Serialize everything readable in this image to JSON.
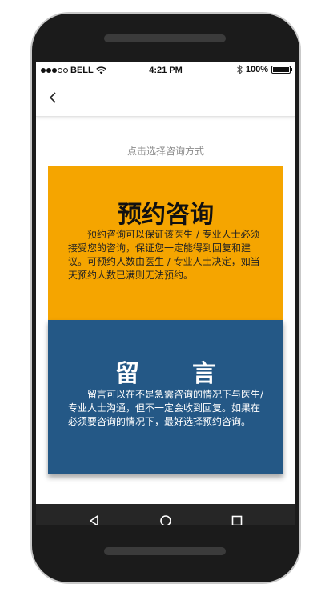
{
  "status_bar": {
    "carrier": "BELL",
    "time": "4:21 PM",
    "battery_text": "100%",
    "battery_level": 1.0,
    "signal_strength": 3,
    "signal_max": 5,
    "icons": [
      "wifi-icon",
      "bluetooth-icon",
      "battery-icon"
    ]
  },
  "nav": {
    "back_icon": "chevron-left-icon"
  },
  "hint": "点击选择咨询方式",
  "options": [
    {
      "title": "预约咨询",
      "description": "预约咨询可以保证该医生 / 专业人士必须接受您的咨询，保证您一定能得到回复和建议。可预约人数由医生 / 专业人士决定，如当天预约人数已满则无法预约。",
      "color": "#f5a500"
    },
    {
      "title": "留言",
      "description": "留言可以在不是急需咨询的情况下与医生/专业人士沟通，但不一定会收到回复。如果在必须要咨询的情况下，最好选择预约咨询。",
      "color": "#245886"
    }
  ],
  "android_nav": {
    "icons": [
      "back-triangle-icon",
      "home-circle-icon",
      "recents-square-icon"
    ]
  },
  "colors": {
    "phone_frame": "#1b1b1b",
    "android_nav_bar": "#262626"
  }
}
